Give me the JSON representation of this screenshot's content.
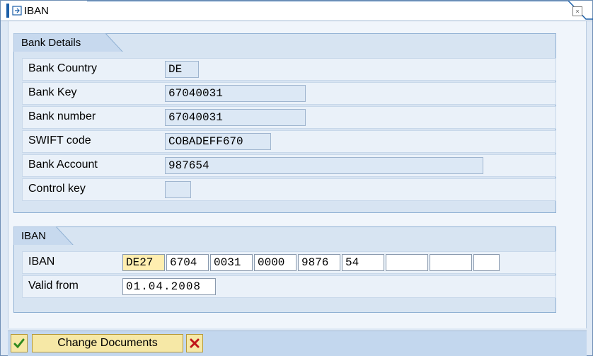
{
  "window": {
    "title": "IBAN",
    "title_icon": "dialog-icon",
    "close_icon": "close-icon"
  },
  "bank_details": {
    "group_title": "Bank Details",
    "rows": [
      {
        "label": "Bank Country",
        "value": ""
      },
      {
        "label": "Bank Key",
        "value": ""
      },
      {
        "label": "Bank number",
        "value": ""
      },
      {
        "label": "SWIFT code",
        "value": ""
      },
      {
        "label": "Bank Account",
        "value": ""
      },
      {
        "label": "Control key",
        "value": ""
      }
    ],
    "bank_country": "DE",
    "bank_key": "67040031",
    "bank_number": "67040031",
    "swift_code": "COBADEFF670",
    "bank_account": "987654",
    "control_key": ""
  },
  "iban_group": {
    "group_title": "IBAN",
    "iban_label": "IBAN",
    "iban_parts": [
      "DE27",
      "6704",
      "0031",
      "0000",
      "9876",
      "54",
      "",
      "",
      ""
    ],
    "valid_from_label": "Valid from",
    "valid_from": "01.04.2008"
  },
  "footer": {
    "confirm_icon": "checkmark-icon",
    "change_documents_label": "Change Documents",
    "cancel_icon": "cancel-x-icon"
  },
  "colors": {
    "accent": "#1c5fa8",
    "group_bg": "#d7e4f2",
    "active_field": "#ffeeb0",
    "button": "#f6e8a6"
  }
}
